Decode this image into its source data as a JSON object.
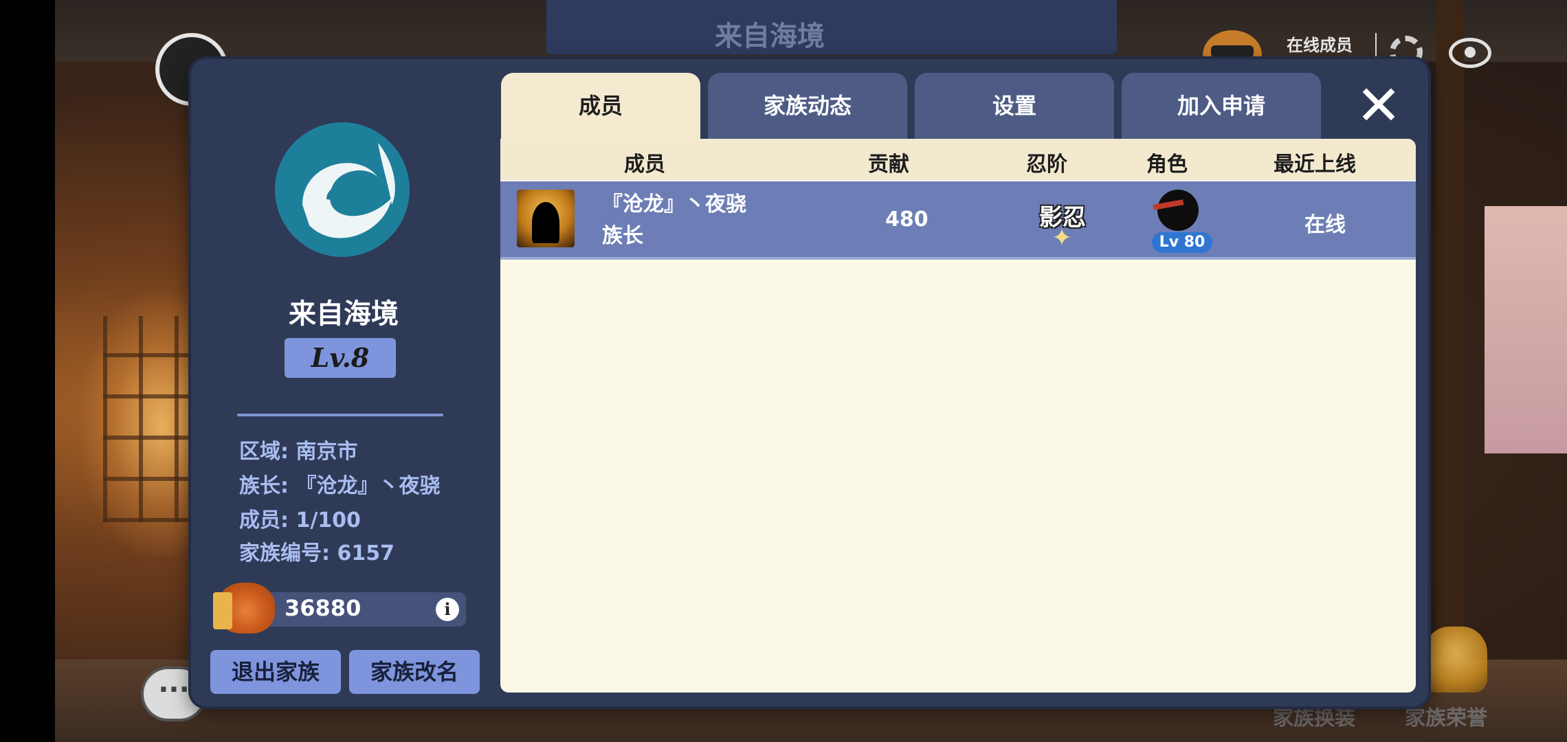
{
  "background": {
    "banner_title": "来自海境",
    "online_label": "在线成员",
    "bottom_labels": [
      "家族换装",
      "家族荣誉"
    ],
    "chat_glyph": "···"
  },
  "clan": {
    "name": "来自海境",
    "level": "Lv.8",
    "region": "区域: 南京市",
    "leader": "族长: 『沧龙』丶夜骁",
    "members": "成员: 1/100",
    "clan_id": "家族编号: 6157",
    "funds": "36880",
    "info_glyph": "i"
  },
  "buttons": {
    "leave": "退出家族",
    "rename": "家族改名",
    "close": "✕"
  },
  "tabs": [
    {
      "label": "成员",
      "active": true
    },
    {
      "label": "家族动态",
      "active": false
    },
    {
      "label": "设置",
      "active": false
    },
    {
      "label": "加入申请",
      "active": false
    }
  ],
  "table": {
    "headers": [
      "成员",
      "贡献",
      "忍阶",
      "角色",
      "最近上线"
    ],
    "rows": [
      {
        "name": "『沧龙』丶夜骁",
        "position": "族长",
        "contribution": "480",
        "rank": "影忍",
        "role_level": "Lv 80",
        "last_online": "在线"
      }
    ]
  }
}
